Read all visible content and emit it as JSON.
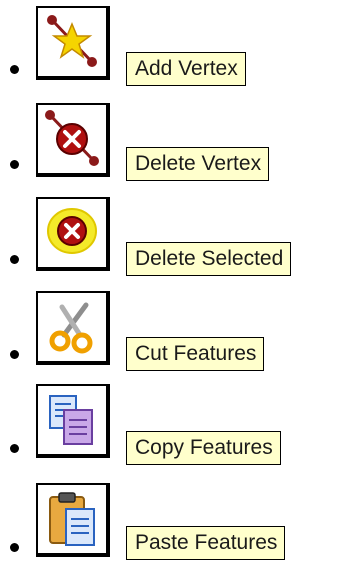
{
  "items": [
    {
      "label": "Add Vertex",
      "icon": "add-vertex-icon"
    },
    {
      "label": "Delete Vertex",
      "icon": "delete-vertex-icon"
    },
    {
      "label": "Delete Selected",
      "icon": "delete-selected-icon"
    },
    {
      "label": "Cut Features",
      "icon": "cut-features-icon"
    },
    {
      "label": "Copy Features",
      "icon": "copy-features-icon"
    },
    {
      "label": "Paste Features",
      "icon": "paste-features-icon"
    }
  ],
  "colors": {
    "label_background": "#ffffcc",
    "vertex_line": "#8b1a1a",
    "star": "#f5d400",
    "delete_red": "#b01010",
    "highlight_yellow": "#f4ea2a"
  }
}
